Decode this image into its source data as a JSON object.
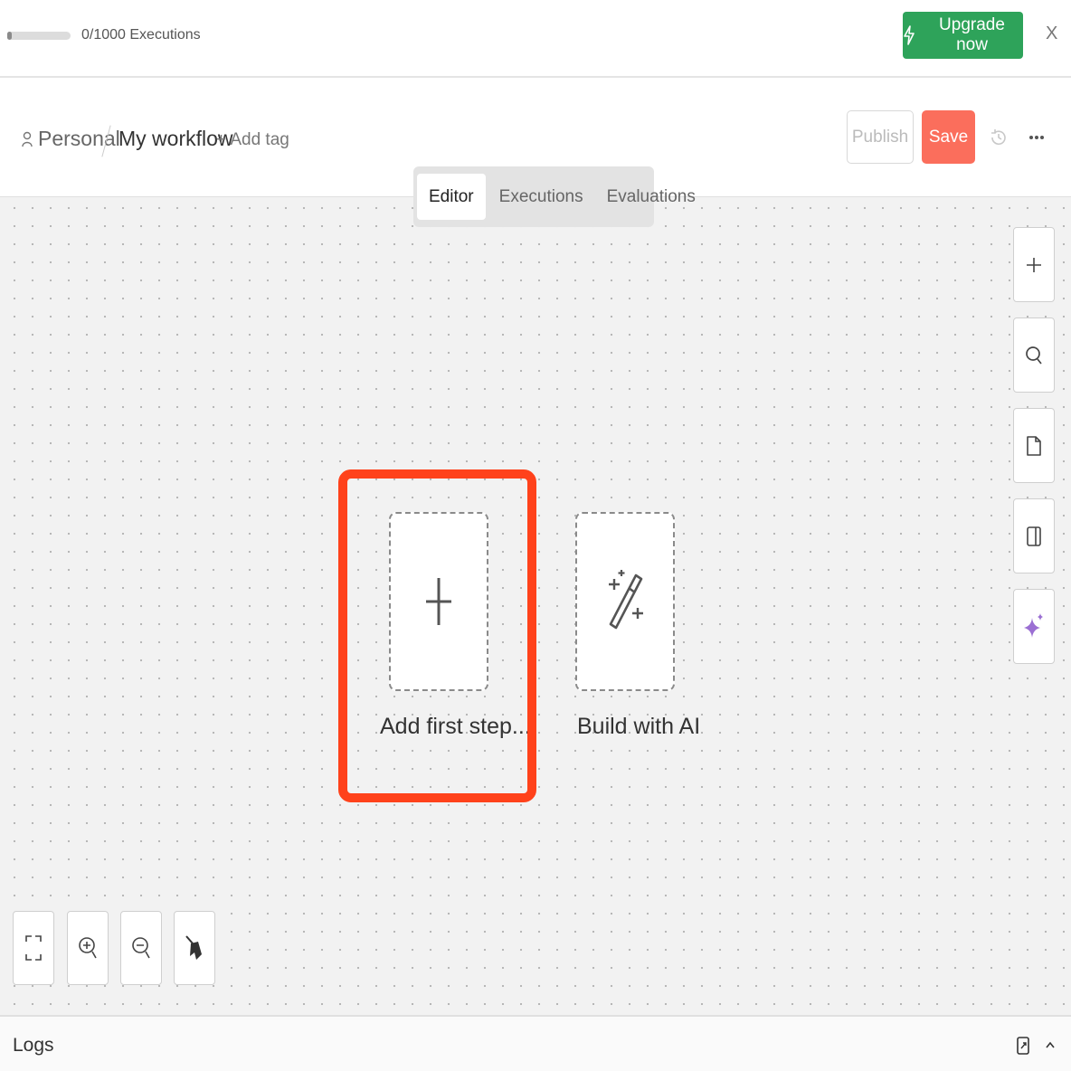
{
  "banner": {
    "executions_text": "0/1000 Executions",
    "executions_used": 0,
    "executions_limit": 1000,
    "upgrade_label": "Upgrade now",
    "close_label": "X",
    "upgrade_color": "#2ea35a"
  },
  "header": {
    "project_label": "Personal",
    "workflow_name": "My workflow",
    "add_tag_label": "+ Add tag",
    "publish_label": "Publish",
    "save_label": "Save",
    "save_color": "#fb6e5c"
  },
  "tabs": [
    {
      "label": "Editor",
      "active": true
    },
    {
      "label": "Executions",
      "active": false
    },
    {
      "label": "Evaluations",
      "active": false
    }
  ],
  "canvas": {
    "add_first_step_label": "Add first step...",
    "build_with_ai_label": "Build with AI",
    "highlight_color": "#ff421b",
    "side_toolbar": [
      "plus-icon",
      "search-icon",
      "document-icon",
      "panel-icon",
      "sparkle-icon"
    ],
    "bottom_toolbar": [
      "fit-view-icon",
      "zoom-in-icon",
      "zoom-out-icon",
      "clean-up-icon"
    ]
  },
  "logs": {
    "label": "Logs"
  }
}
